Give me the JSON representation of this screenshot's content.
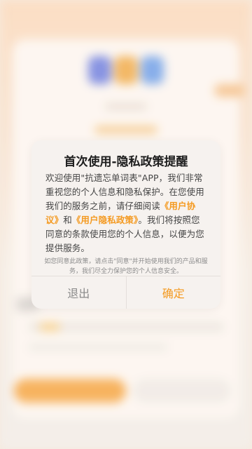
{
  "dialog": {
    "title": "首次使用-隐私政策提醒",
    "body_part1": "欢迎使用\"抗遗忘单词表\"APP，我们非常重视您的个人信息和隐私保护。在您使用我们的服务之前，请仔细阅读",
    "user_agreement_link": "《用户协议》",
    "and_text": "和",
    "privacy_policy_link": "《用户隐私政策》",
    "body_part2": "。我们将按照您同意的条款使用您的个人信息，以便为您提供服务。",
    "note": "如您同意此政策，请点击\"同意\"并开始使用我们的产品和服务，我们尽全力保护您的个人信息安全。",
    "cancel_label": "退出",
    "confirm_label": "确定"
  },
  "colors": {
    "accent": "#f49a21",
    "dialog_bg": "#f6f2ef",
    "cancel_text": "#8a8a8a"
  }
}
